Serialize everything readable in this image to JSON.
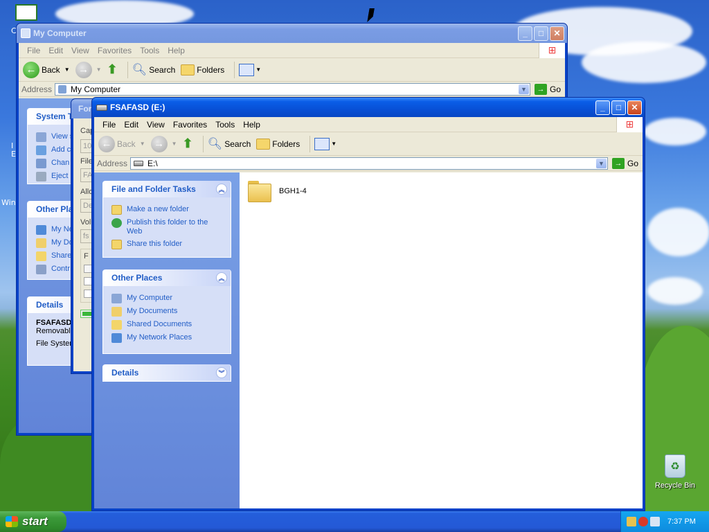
{
  "desktop": {
    "recycle_bin_label": "Recycle Bin",
    "left_edge_labels": [
      "C",
      "I",
      "E",
      "Win"
    ]
  },
  "back_window": {
    "title": "My Computer",
    "menu": [
      "File",
      "Edit",
      "View",
      "Favorites",
      "Tools",
      "Help"
    ],
    "toolbar": {
      "back": "Back",
      "search": "Search",
      "folders": "Folders"
    },
    "address_label": "Address",
    "address_value": "My Computer",
    "go": "Go",
    "system_tasks_header": "System T",
    "system_tasks": [
      "View s",
      "Add c",
      "Chan",
      "Eject"
    ],
    "other_places_header": "Other Pla",
    "other_places": [
      "My Ne",
      "My Do",
      "Share",
      "Contr"
    ],
    "details_header": "Details",
    "details_name": "FSAFASD",
    "details_type": "Removable",
    "details_fs": "File System"
  },
  "format_dialog": {
    "title": "Forr",
    "labels": [
      "Cap",
      "10",
      "File",
      "FA",
      "Allo",
      "De",
      "Volu",
      "fs",
      "F"
    ]
  },
  "front_window": {
    "title": "FSAFASD (E:)",
    "menu": [
      "File",
      "Edit",
      "View",
      "Favorites",
      "Tools",
      "Help"
    ],
    "toolbar": {
      "back": "Back",
      "search": "Search",
      "folders": "Folders"
    },
    "address_label": "Address",
    "address_value": "E:\\",
    "go": "Go",
    "file_tasks": {
      "header": "File and Folder Tasks",
      "items": [
        "Make a new folder",
        "Publish this folder to the Web",
        "Share this folder"
      ]
    },
    "other_places": {
      "header": "Other Places",
      "items": [
        "My Computer",
        "My Documents",
        "Shared Documents",
        "My Network Places"
      ]
    },
    "details": {
      "header": "Details"
    },
    "files": [
      {
        "name": "BGH1-4",
        "icon": "folder-icon"
      }
    ]
  },
  "taskbar": {
    "start_label": "start",
    "clock": "7:37 PM"
  }
}
